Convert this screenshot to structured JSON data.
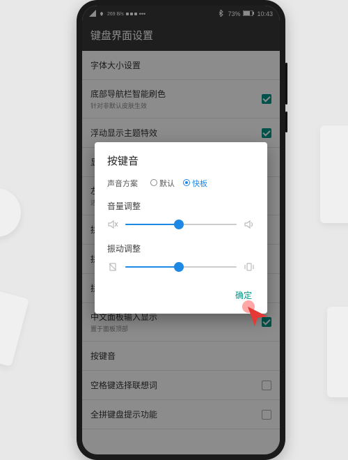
{
  "status_bar": {
    "net_speed": "269 B/s",
    "battery_text": "73%",
    "time": "10:43",
    "bt_icon": "bluetooth-icon"
  },
  "page_title": "键盘界面设置",
  "settings": [
    {
      "label": "字体大小设置",
      "sub": "",
      "checked": null
    },
    {
      "label": "底部导航栏智能刷色",
      "sub": "针对非默认皮肤生效",
      "checked": true
    },
    {
      "label": "浮动显示主题特效",
      "sub": "",
      "checked": true
    },
    {
      "label": "显",
      "sub": "",
      "checked": null
    },
    {
      "label": "左",
      "sub": "适",
      "checked": null
    },
    {
      "label": "拼",
      "sub": "",
      "checked": null
    },
    {
      "label": "拼",
      "sub": "",
      "checked": null
    },
    {
      "label": "拼",
      "sub": "",
      "checked": null
    },
    {
      "label": "中文面板输入显示",
      "sub": "置于面板顶部",
      "checked": true
    },
    {
      "label": "按键音",
      "sub": "",
      "checked": null
    },
    {
      "label": "空格键选择联想词",
      "sub": "",
      "checked": false
    },
    {
      "label": "全拼键盘提示功能",
      "sub": "",
      "checked": false
    }
  ],
  "dialog": {
    "title": "按键音",
    "radio_label": "声音方案",
    "radio_options": [
      "默认",
      "快板"
    ],
    "radio_selected": 1,
    "volume_label": "音量调整",
    "volume_percent": 48,
    "vibrate_label": "振动调整",
    "vibrate_percent": 48,
    "ok_label": "确定"
  },
  "colors": {
    "accent_green": "#009688",
    "accent_blue": "#1e88e5"
  }
}
